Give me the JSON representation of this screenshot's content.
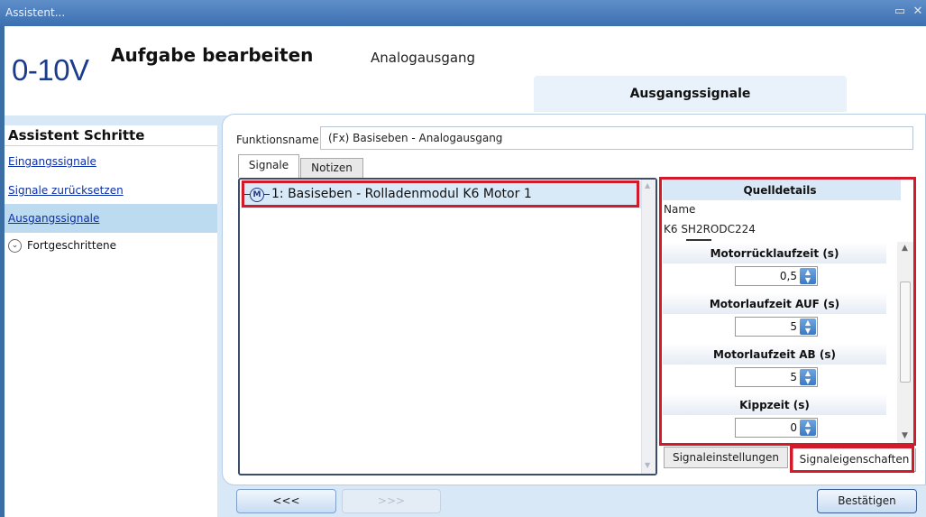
{
  "window": {
    "title": "Assistent...",
    "controls": [
      "restore",
      "close"
    ]
  },
  "header": {
    "logo": "0-10V",
    "title": "Aufgabe bearbeiten",
    "subtitle": "Analogausgang",
    "step_tab": "Ausgangssignale"
  },
  "sidebar": {
    "heading": "Assistent Schritte",
    "items": [
      {
        "label": "Eingangssignale"
      },
      {
        "label": "Signale zurücksetzen"
      },
      {
        "label": "Ausgangssignale",
        "active": true
      }
    ],
    "advanced": {
      "label": "Fortgeschrittene",
      "icon": "chevron-down-circle-icon"
    }
  },
  "content": {
    "function_label": "Funktionsname",
    "function_value": "(Fx) Basiseben - Analogausgang",
    "tabs": [
      "Signale",
      "Notizen"
    ],
    "signals": [
      {
        "badge": "M",
        "label": "1: Basiseben - Rolladenmodul K6 Motor 1"
      }
    ],
    "details": {
      "title": "Quelldetails",
      "name_label": "Name",
      "name_value": "K6 SH2RODC224",
      "properties": [
        {
          "label": "Motorrücklaufzeit (s)",
          "value": "0,5"
        },
        {
          "label": "Motorlaufzeit AUF (s)",
          "value": "5"
        },
        {
          "label": "Motorlaufzeit AB (s)",
          "value": "5"
        },
        {
          "label": "Kippzeit (s)",
          "value": "0"
        }
      ]
    },
    "bottom_tabs": [
      "Signaleinstellungen",
      "Signaleigenschaften"
    ]
  },
  "footer": {
    "back": "<<<",
    "next": ">>>",
    "confirm": "Bestätigen"
  },
  "colors": {
    "highlight": "#d11a2a",
    "accent": "#3b6fb0",
    "logo": "#1b3c8c"
  }
}
